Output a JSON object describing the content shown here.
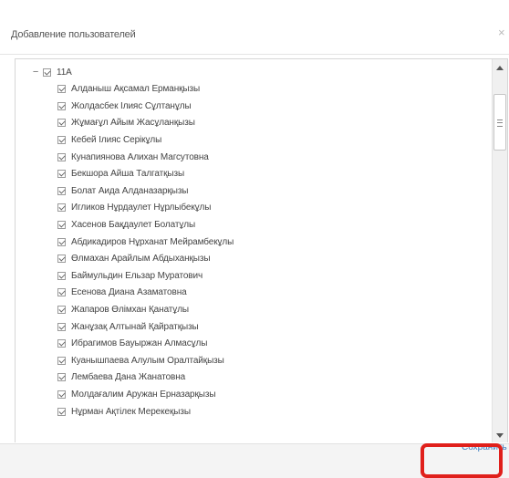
{
  "dialog": {
    "title": "Добавление пользователей",
    "close_glyph": "×",
    "save_label": "Сохранить",
    "highlight_color": "#e0201b"
  },
  "tree": {
    "group": {
      "expander": "−",
      "label": "11А",
      "checked": true
    },
    "students": [
      {
        "label": "Алданыш Ақсамал Ерманқызы",
        "checked": true
      },
      {
        "label": "Жолдасбек Ілияс Сұлтанұлы",
        "checked": true
      },
      {
        "label": "Жұмағұл Айым Жасұланқызы",
        "checked": true
      },
      {
        "label": "Кебей Ілияс Серікұлы",
        "checked": true
      },
      {
        "label": "Кунапиянова Алихан Магсутовна",
        "checked": true
      },
      {
        "label": "Бекшора Айша Талгатқызы",
        "checked": true
      },
      {
        "label": "Болат Аида Алданазарқызы",
        "checked": true
      },
      {
        "label": "Игликов Нұрдаулет Нұрлыбекұлы",
        "checked": true
      },
      {
        "label": "Хасенов Бақдаулет Болатұлы",
        "checked": true
      },
      {
        "label": "Абдикадиров Нұрханат Мейрамбекұлы",
        "checked": true
      },
      {
        "label": "Өлмахан Арайлым Абдыханқызы",
        "checked": true
      },
      {
        "label": "Баймульдин Ельзар Муратович",
        "checked": true
      },
      {
        "label": "Есенова Диана Азаматовна",
        "checked": true
      },
      {
        "label": "Жапаров Өлімхан Қанатұлы",
        "checked": true
      },
      {
        "label": "Жанұзақ Алтынай Қайратқызы",
        "checked": true
      },
      {
        "label": "Ибрагимов Бауыржан Алмасұлы",
        "checked": true
      },
      {
        "label": "Куанышпаева Алулым Оралтайқызы",
        "checked": true
      },
      {
        "label": "Лембаева Дана Жанатовна",
        "checked": true
      },
      {
        "label": "Молдағалим Аружан Ерназарқызы",
        "checked": true
      },
      {
        "label": "Нұрман Ақтілек Мерекеқызы",
        "checked": true
      }
    ]
  }
}
